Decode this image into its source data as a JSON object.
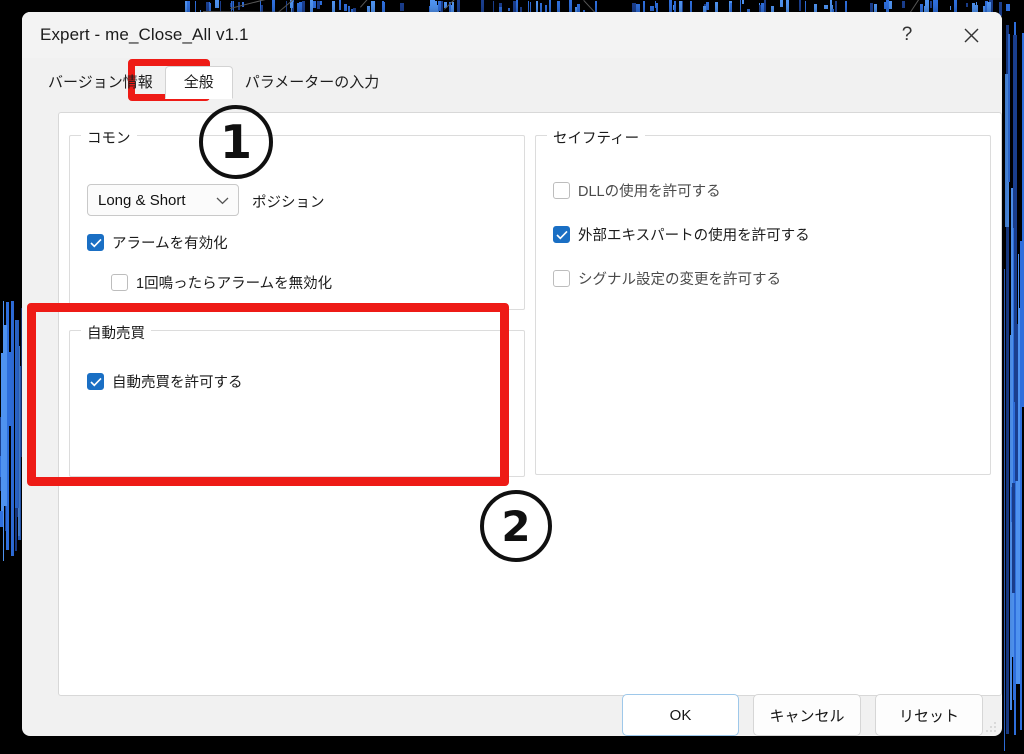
{
  "window": {
    "title": "Expert - me_Close_All v1.1",
    "help_icon": "help-question-icon",
    "close_icon": "close-icon"
  },
  "tabs": [
    {
      "label": "バージョン情報",
      "selected": false
    },
    {
      "label": "全般",
      "selected": true
    },
    {
      "label": "パラメーターの入力",
      "selected": false
    }
  ],
  "groups": {
    "common": {
      "title": "コモン",
      "combo": {
        "value": "Long & Short",
        "chevron_icon": "chevron-down-icon"
      },
      "combo_label": "ポジション",
      "checkboxes": [
        {
          "label": "アラームを有効化",
          "checked": true
        },
        {
          "label": "1回鳴ったらアラームを無効化",
          "checked": false
        }
      ]
    },
    "safety": {
      "title": "セイフティー",
      "checkboxes": [
        {
          "label": "DLLの使用を許可する",
          "checked": false
        },
        {
          "label": "外部エキスパートの使用を許可する",
          "checked": true
        },
        {
          "label": "シグナル設定の変更を許可する",
          "checked": false
        }
      ]
    },
    "autotrade": {
      "title": "自動売買",
      "checkboxes": [
        {
          "label": "自動売買を許可する",
          "checked": true
        }
      ]
    }
  },
  "footer": {
    "ok_label": "OK",
    "cancel_label": "キャンセル",
    "reset_label": "リセット"
  },
  "annotations": {
    "step_one": "1",
    "step_two": "2",
    "highlight_color": "#ee1b16"
  },
  "colors": {
    "accent_checkbox": "#1a6fc4",
    "annotation_red": "#ee1b16",
    "dialog_background": "#f1f1f1",
    "panel_background": "#ffffff",
    "chart_background": "#000000",
    "candle_blue": "#2f6fdd"
  }
}
